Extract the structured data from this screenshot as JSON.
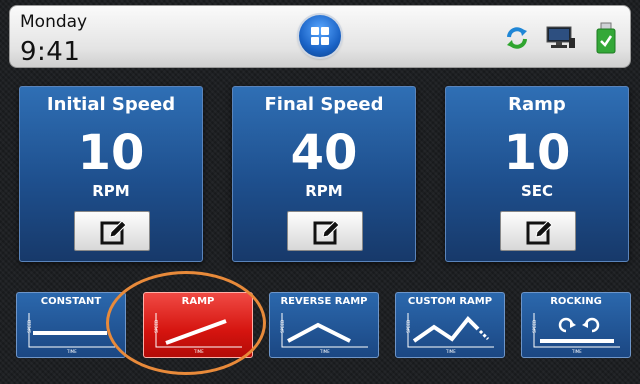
{
  "header": {
    "day": "Monday",
    "time": "9:41",
    "icons": [
      "sync-icon",
      "monitor-icon",
      "usb-drive-icon"
    ]
  },
  "cards": [
    {
      "title": "Initial Speed",
      "value": "10",
      "unit": "RPM"
    },
    {
      "title": "Final Speed",
      "value": "40",
      "unit": "RPM"
    },
    {
      "title": "Ramp",
      "value": "10",
      "unit": "SEC"
    }
  ],
  "modes": [
    {
      "label": "CONSTANT",
      "active": false
    },
    {
      "label": "RAMP",
      "active": true
    },
    {
      "label": "REVERSE RAMP",
      "active": false
    },
    {
      "label": "CUSTOM RAMP",
      "active": false
    },
    {
      "label": "ROCKING",
      "active": false
    }
  ],
  "graph_labels": {
    "x": "TIME",
    "y": "SPEED"
  },
  "colors": {
    "card": "#1e4f8d",
    "active": "#d5140f",
    "highlight": "#e88a3a",
    "accent_green": "#2fa52f"
  }
}
